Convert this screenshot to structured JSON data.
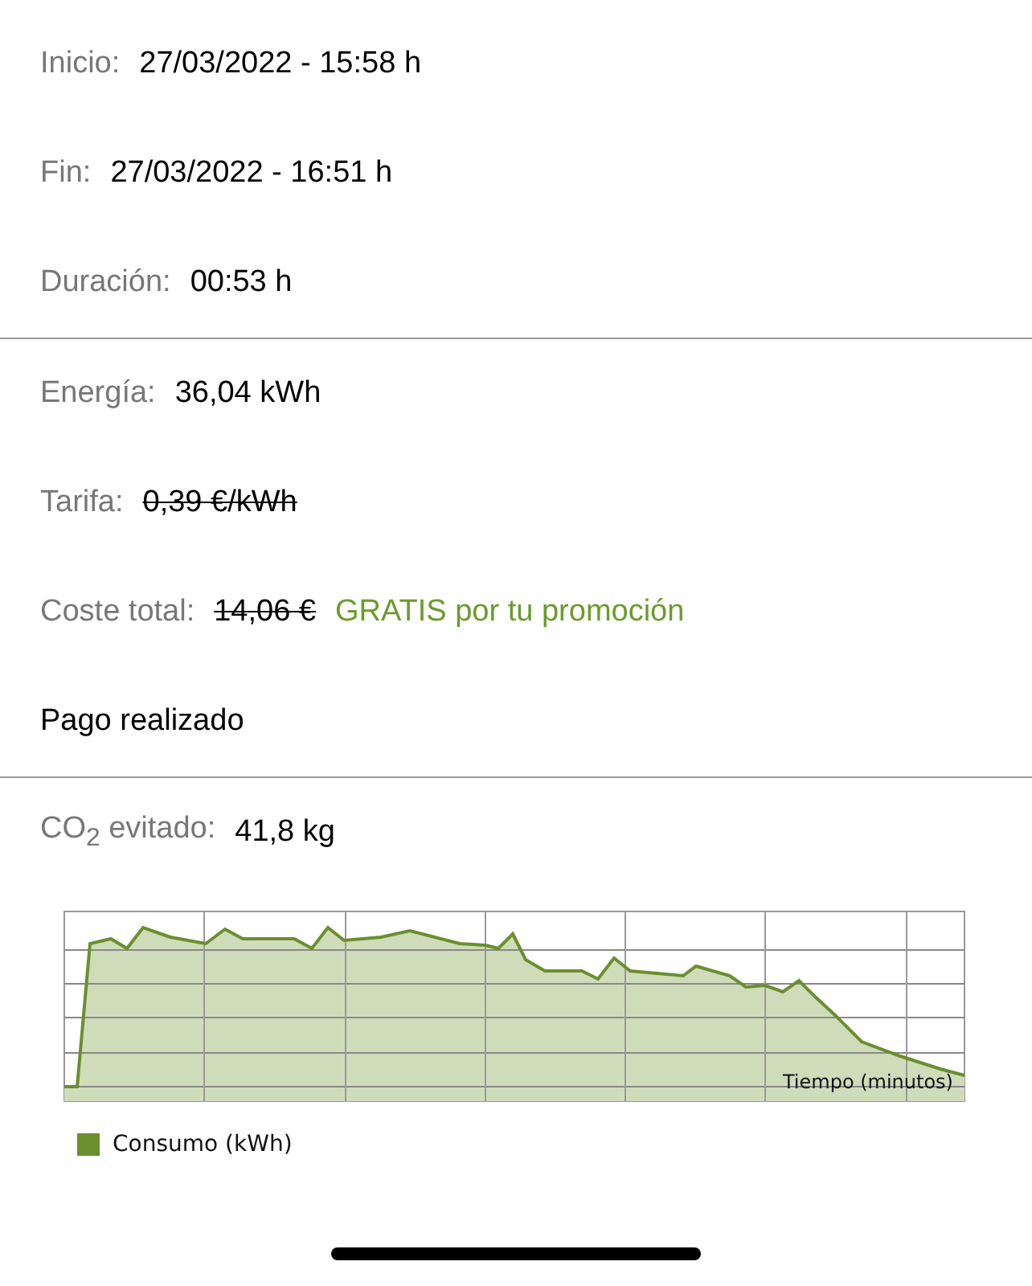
{
  "sections": [
    {
      "rows": [
        {
          "kind": "field",
          "label": "Inicio:",
          "value": "27/03/2022 - 15:58 h",
          "struck": false
        },
        {
          "kind": "field",
          "label": "Fin:",
          "value": "27/03/2022 - 16:51 h",
          "struck": false
        },
        {
          "kind": "field",
          "label": "Duración:",
          "value": "00:53 h",
          "struck": false
        }
      ]
    },
    {
      "rows": [
        {
          "kind": "field",
          "label": "Energía:",
          "value": "36,04 kWh",
          "struck": false
        },
        {
          "kind": "field",
          "label": "Tarifa:",
          "value": "0,39 €/kWh",
          "struck": true
        },
        {
          "kind": "field",
          "label": "Coste total:",
          "value": "14,06 €",
          "struck": true,
          "note": "GRATIS por tu promoción"
        },
        {
          "kind": "status",
          "text": "Pago realizado"
        }
      ]
    },
    {
      "rows": [
        {
          "kind": "field",
          "label": "CO$_{2}$ evitado:",
          "value": "41,8 kg",
          "struck": false
        }
      ]
    }
  ],
  "chart": {
    "axis_label": "Tiempo (minutos)",
    "legend": [
      {
        "label": "Consumo (kWh)",
        "color": "#6b8e2f"
      }
    ]
  }
}
